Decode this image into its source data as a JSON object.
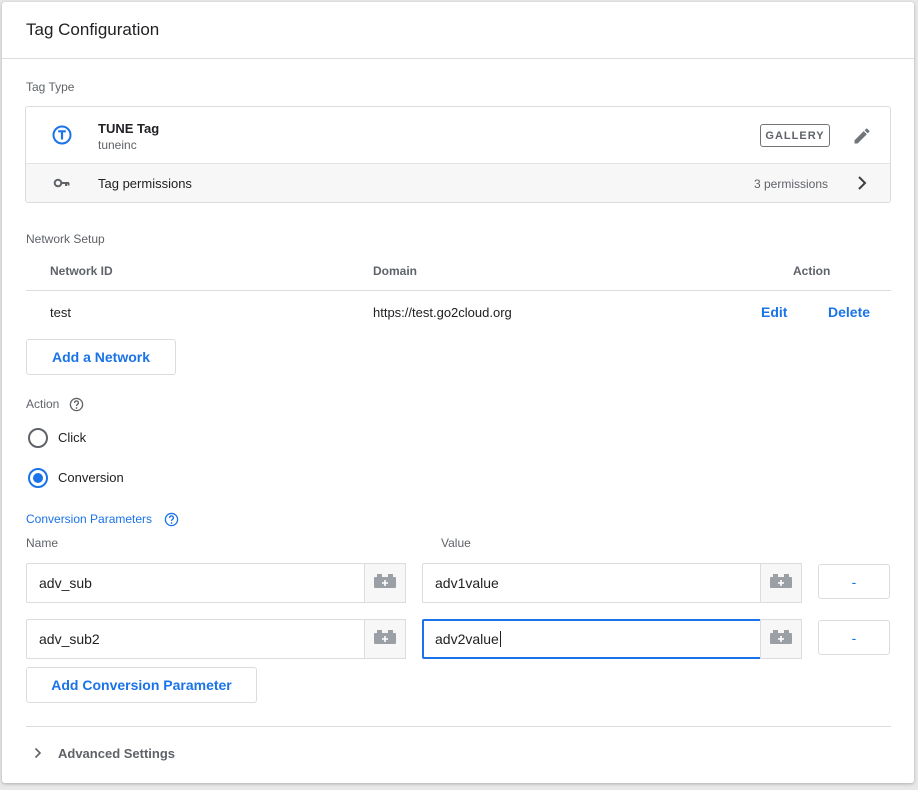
{
  "header": {
    "title": "Tag Configuration"
  },
  "tag_type": {
    "label": "Tag Type",
    "tag_name": "TUNE Tag",
    "vendor": "tuneinc",
    "gallery_label": "GALLERY",
    "permissions_label": "Tag permissions",
    "permissions_count": "3 permissions"
  },
  "network_setup": {
    "label": "Network Setup",
    "columns": [
      "Network ID",
      "Domain",
      "Action"
    ],
    "rows": [
      {
        "network_id": "test",
        "domain": "https://test.go2cloud.org",
        "edit": "Edit",
        "delete": "Delete"
      }
    ],
    "add_button": "Add a Network"
  },
  "action": {
    "label": "Action",
    "options": [
      {
        "label": "Click",
        "selected": false
      },
      {
        "label": "Conversion",
        "selected": true
      }
    ]
  },
  "conversion_params": {
    "label": "Conversion Parameters",
    "name_header": "Name",
    "value_header": "Value",
    "rows": [
      {
        "name": "adv_sub",
        "value": "adv1value",
        "remove": "-"
      },
      {
        "name": "adv_sub2",
        "value": "adv2value",
        "remove": "-"
      }
    ],
    "add_button": "Add Conversion Parameter"
  },
  "advanced": {
    "label": "Advanced Settings"
  },
  "colors": {
    "accent": "#1a73e8",
    "text": "#202124",
    "muted": "#5f6368",
    "border": "#dadce0"
  }
}
